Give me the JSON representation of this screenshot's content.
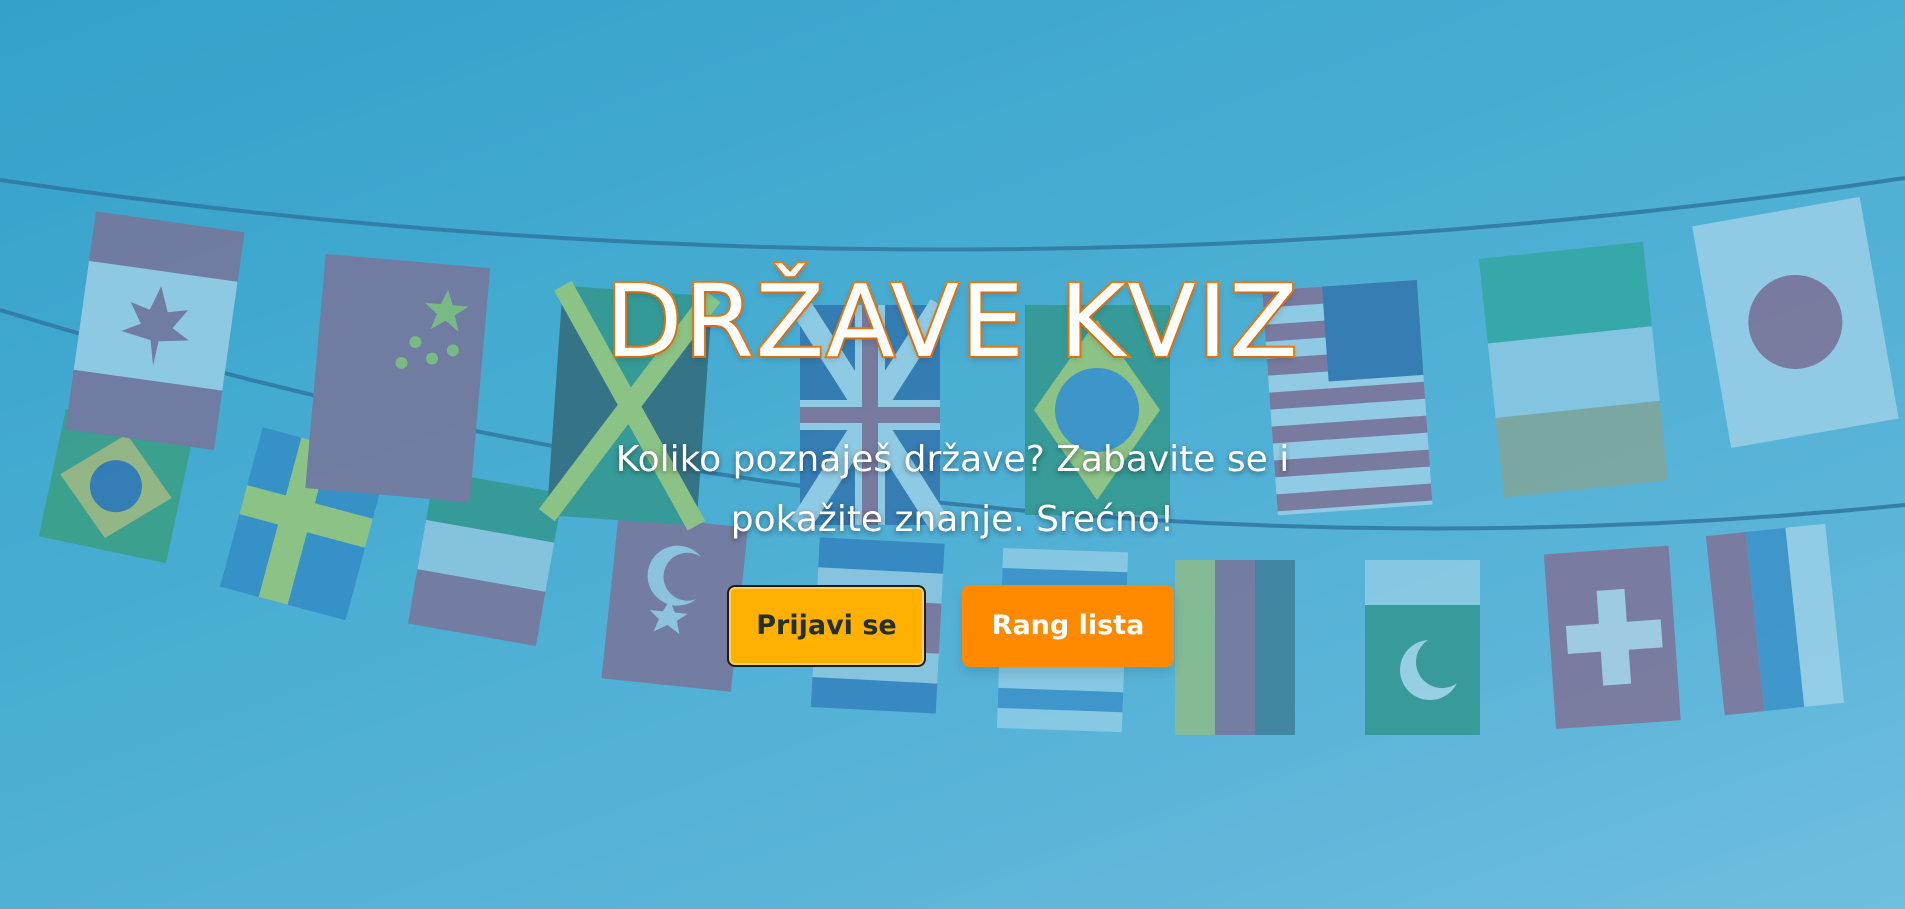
{
  "hero": {
    "title": "DRŽAVE KVIZ",
    "subtitle": "Koliko poznaješ države? Zabavite se i pokažite znanje. Srećno!"
  },
  "buttons": {
    "login_label": "Prijavi se",
    "ranking_label": "Rang lista"
  },
  "colors": {
    "title_fill": "#ffffff",
    "title_outline": "#f47b0d",
    "login_button_bg": "#ffb000",
    "ranking_button_bg": "#ff8a00",
    "background": "#4fb0d3"
  },
  "background_image": {
    "icon": "flag-bunting-illustration"
  }
}
